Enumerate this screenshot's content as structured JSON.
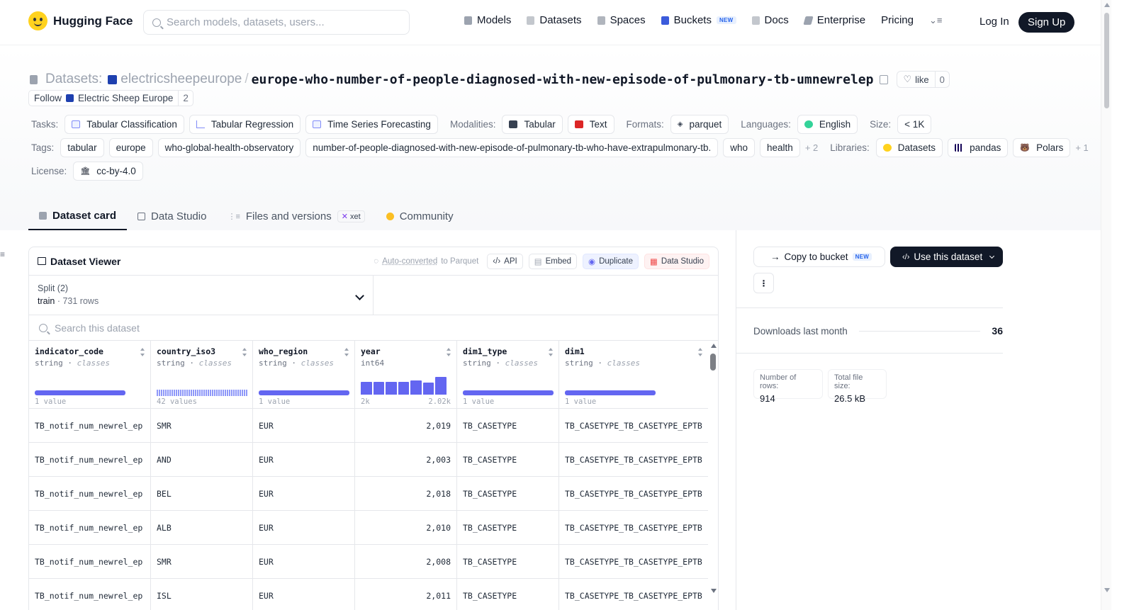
{
  "nav": {
    "brand": "Hugging Face",
    "search_placeholder": "Search models, datasets, users...",
    "links": [
      "Models",
      "Datasets",
      "Spaces",
      "Buckets",
      "Docs",
      "Enterprise",
      "Pricing"
    ],
    "new_badge": "NEW",
    "login": "Log In",
    "signup": "Sign Up"
  },
  "repo": {
    "type_label": "Datasets:",
    "owner": "electricsheepeurope",
    "name": "europe-who-number-of-people-diagnosed-with-new-episode-of-pulmonary-tb-umnewrelep",
    "like_label": "like",
    "like_count": "0",
    "follow_label": "Follow",
    "org_name": "Electric Sheep Europe",
    "follower_count": "2"
  },
  "meta": {
    "tasks_label": "Tasks:",
    "tasks": [
      "Tabular Classification",
      "Tabular Regression",
      "Time Series Forecasting"
    ],
    "modalities_label": "Modalities:",
    "modalities": [
      "Tabular",
      "Text"
    ],
    "formats_label": "Formats:",
    "formats": [
      "parquet"
    ],
    "languages_label": "Languages:",
    "languages": [
      "English"
    ],
    "size_label": "Size:",
    "size": "< 1K",
    "tags_label": "Tags:",
    "tags": [
      "tabular",
      "europe",
      "who-global-health-observatory",
      "number-of-people-diagnosed-with-new-episode-of-pulmonary-tb-who-have-extrapulmonary-tb.",
      "who",
      "health"
    ],
    "tags_more": "+ 2",
    "libraries_label": "Libraries:",
    "libraries": [
      "Datasets",
      "pandas",
      "Polars"
    ],
    "libraries_more": "+ 1",
    "license_label": "License:",
    "license": "cc-by-4.0"
  },
  "tabs": {
    "card": "Dataset card",
    "studio": "Data Studio",
    "files": "Files and versions",
    "xet": "xet",
    "community": "Community"
  },
  "viewer": {
    "title": "Dataset Viewer",
    "auto_converted": "Auto-converted",
    "to_parquet": "to Parquet",
    "api": "API",
    "embed": "Embed",
    "duplicate": "Duplicate",
    "data_studio": "Data Studio",
    "split_label": "Split (2)",
    "split_name": "train",
    "split_rows": "731 rows",
    "search_placeholder": "Search this dataset",
    "columns": [
      {
        "name": "indicator_code",
        "type": "string",
        "kind": "classes",
        "foot_l": "1 value",
        "foot_r": ""
      },
      {
        "name": "country_iso3",
        "type": "string",
        "kind": "classes",
        "foot_l": "42 values",
        "foot_r": ""
      },
      {
        "name": "who_region",
        "type": "string",
        "kind": "classes",
        "foot_l": "1 value",
        "foot_r": ""
      },
      {
        "name": "year",
        "type": "int64",
        "kind": "",
        "foot_l": "2k",
        "foot_r": "2.02k"
      },
      {
        "name": "dim1_type",
        "type": "string",
        "kind": "classes",
        "foot_l": "1 value",
        "foot_r": ""
      },
      {
        "name": "dim1",
        "type": "string",
        "kind": "classes",
        "foot_l": "1 value",
        "foot_r": ""
      }
    ],
    "year_histogram": [
      0.65,
      0.65,
      0.65,
      0.65,
      0.7,
      0.6,
      0.9
    ],
    "rows": [
      [
        "TB_notif_num_newrel_ep",
        "SMR",
        "EUR",
        "2,019",
        "TB_CASETYPE",
        "TB_CASETYPE_TB_CASETYPE_EPTB"
      ],
      [
        "TB_notif_num_newrel_ep",
        "AND",
        "EUR",
        "2,003",
        "TB_CASETYPE",
        "TB_CASETYPE_TB_CASETYPE_EPTB"
      ],
      [
        "TB_notif_num_newrel_ep",
        "BEL",
        "EUR",
        "2,018",
        "TB_CASETYPE",
        "TB_CASETYPE_TB_CASETYPE_EPTB"
      ],
      [
        "TB_notif_num_newrel_ep",
        "ALB",
        "EUR",
        "2,010",
        "TB_CASETYPE",
        "TB_CASETYPE_TB_CASETYPE_EPTB"
      ],
      [
        "TB_notif_num_newrel_ep",
        "SMR",
        "EUR",
        "2,008",
        "TB_CASETYPE",
        "TB_CASETYPE_TB_CASETYPE_EPTB"
      ],
      [
        "TB_notif_num_newrel_ep",
        "ISL",
        "EUR",
        "2,011",
        "TB_CASETYPE",
        "TB_CASETYPE_TB_CASETYPE_EPTB"
      ]
    ]
  },
  "sidebar": {
    "copy_bucket": "Copy to bucket",
    "new_badge": "NEW",
    "use_dataset": "Use this dataset",
    "downloads_label": "Downloads last month",
    "downloads_value": "36",
    "rows_label": "Number of rows:",
    "rows_value": "914",
    "filesize_label": "Total file size:",
    "filesize_value": "26.5 kB"
  }
}
